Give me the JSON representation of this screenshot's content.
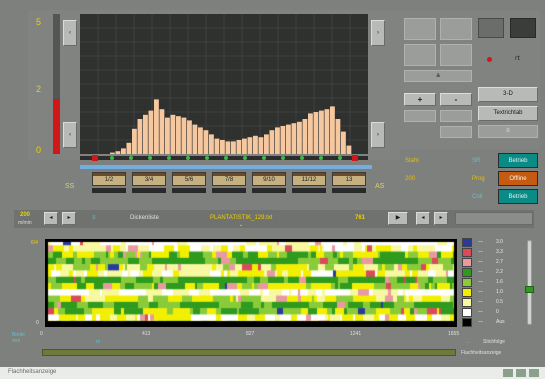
{
  "colors": {
    "accent_yellow": "#f0d000",
    "peach": "#f5c8a0",
    "status_teal": "#0a8b86",
    "status_orange": "#c55a11"
  },
  "top_chart": {
    "y_ticks": [
      "5",
      "2",
      "0"
    ],
    "left_region_label": "SS",
    "right_region_label": "AS"
  },
  "chart_data": {
    "type": "bar",
    "title": "",
    "ylim": [
      0,
      5
    ],
    "values": [
      0.05,
      0.1,
      0.2,
      0.4,
      0.9,
      1.25,
      1.4,
      1.55,
      1.95,
      1.6,
      1.3,
      1.4,
      1.35,
      1.3,
      1.2,
      1.05,
      0.95,
      0.85,
      0.7,
      0.55,
      0.5,
      0.45,
      0.45,
      0.5,
      0.55,
      0.6,
      0.65,
      0.6,
      0.7,
      0.85,
      0.95,
      1.0,
      1.05,
      1.1,
      1.15,
      1.25,
      1.45,
      1.5,
      1.55,
      1.6,
      1.7,
      1.25,
      0.8,
      0.3
    ]
  },
  "positions": [
    {
      "label": "1/2"
    },
    {
      "label": "3/4"
    },
    {
      "label": "5/6"
    },
    {
      "label": "7/8"
    },
    {
      "label": "9/10"
    },
    {
      "label": "11/12"
    },
    {
      "label": "13"
    }
  ],
  "controls": {
    "view_3d": "3-D",
    "text_button": "Textrichtab",
    "small_label_a": "a",
    "small_label_b": "b",
    "mid_label": "rt"
  },
  "status": {
    "row1_left": "Stahl",
    "row1_mid": "SR",
    "row1_btn": "Betrieb",
    "row2_left": "200",
    "row2_mid": "Prog",
    "row2_btn": "Offline",
    "row3_mid": "Coil",
    "row3_btn": "Betrieb"
  },
  "toolbar": {
    "num_value": "200",
    "num_unit": "m/min",
    "col_label": "Dickenliste",
    "file_name": "PLANTATISTIK_129.txt",
    "page_number": "761"
  },
  "heatmap": {
    "legend": [
      {
        "value": "3.0",
        "color": "#2a3a9a"
      },
      {
        "value": "3.3",
        "color": "#d94a5a"
      },
      {
        "value": "2.7",
        "color": "#e89aa0"
      },
      {
        "value": "2.2",
        "color": "#2e9a1e"
      },
      {
        "value": "1.6",
        "color": "#8acb3a"
      },
      {
        "value": "1.0",
        "color": "#f2f000"
      },
      {
        "value": "0.5",
        "color": "#f8f8a0"
      },
      {
        "value": "0",
        "color": "#ffffff"
      },
      {
        "value": "Aus",
        "color": "#000000"
      }
    ],
    "x_ticks": [
      "0",
      "413",
      "827",
      "1241",
      "1655"
    ],
    "y_top": "6/4",
    "y_bottom": "0",
    "left_bottom_label": "Breite\nmm",
    "under_label": "m",
    "right_note_1": "Stichfolge",
    "right_note_2": "Flachheitsanzeige"
  },
  "bottom": {
    "taskbar_text": "Flachheitsanzeige"
  }
}
